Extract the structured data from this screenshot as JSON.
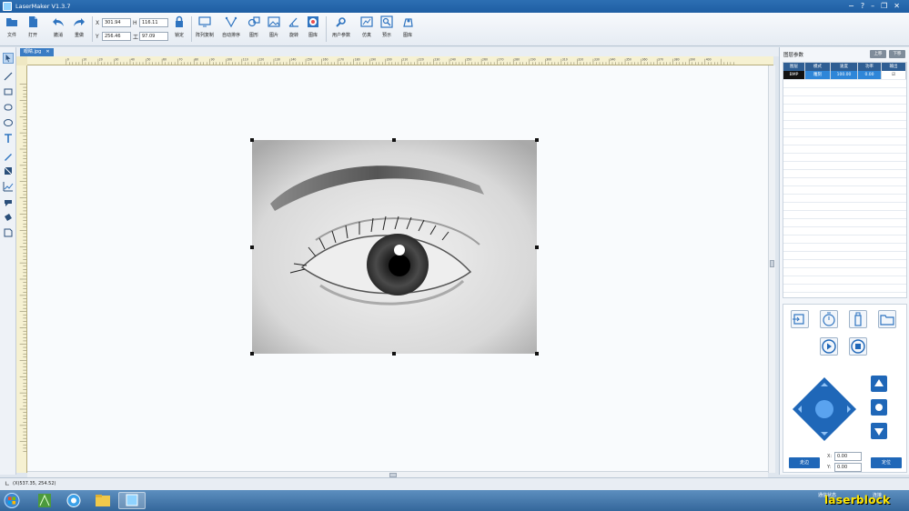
{
  "window": {
    "title": "LaserMaker V1.3.7",
    "controls": [
      "−",
      "?",
      "–",
      "❐",
      "✕"
    ]
  },
  "toolbar": {
    "file": "文件",
    "open": "打开",
    "undo": "撤消",
    "redo": "重做",
    "x_label": "X",
    "x_value": "301.94",
    "y_label": "Y",
    "y_value": "256.46",
    "w_label": "H",
    "w_value": "116.11",
    "h_label": "工",
    "h_value": "97.09",
    "lock": "锁定",
    "array": "阵列复制",
    "auto": "自动排序",
    "shape": "图形",
    "image": "图片",
    "rotate": "旋转",
    "library": "图库",
    "user_params": "用户参数",
    "simulate": "仿真",
    "preview": "预示",
    "gallery": "图库"
  },
  "document": {
    "tab_name": "眼睛.jpg",
    "tab_close": "✕"
  },
  "ruler_ticks": [
    "0",
    "10",
    "20",
    "30",
    "40",
    "50",
    "60",
    "70",
    "80",
    "90",
    "100",
    "110",
    "120",
    "130",
    "140",
    "150",
    "160",
    "170",
    "180",
    "190",
    "200",
    "210",
    "220",
    "230",
    "240",
    "250",
    "260",
    "270",
    "280",
    "290",
    "300",
    "310",
    "320",
    "330",
    "340",
    "350",
    "360",
    "370",
    "380",
    "390",
    "400"
  ],
  "right_panel": {
    "title": "图层参数",
    "btn_up": "上移",
    "btn_down": "下移",
    "headers": [
      "图层",
      "模式",
      "速度",
      "功率",
      "输出"
    ],
    "row": {
      "layer": "BMP",
      "mode": "雕刻",
      "speed": "100.00",
      "power": "0.00",
      "output": "☑"
    },
    "x_label": "X:",
    "x_value": "0.00",
    "y_label": "Y:",
    "y_value": "0.00",
    "start_btn": "走边",
    "reset_btn": "定位"
  },
  "status": {
    "coords": "(X)537.35, 254.52)"
  },
  "taskbar": {
    "connection": "通信状态",
    "connection_state": "连接"
  },
  "watermark": "laserblock"
}
